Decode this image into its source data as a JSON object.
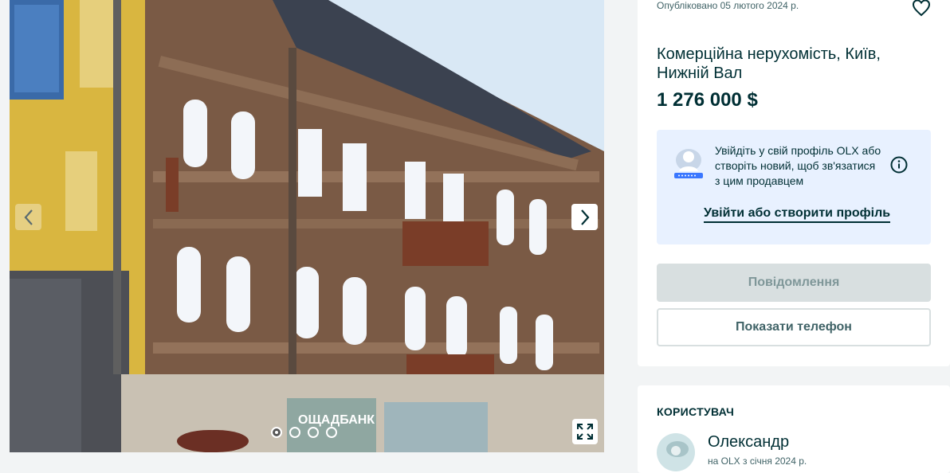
{
  "gallery": {
    "photo_alt": "",
    "slide_count": 4,
    "active_slide": 1
  },
  "listing": {
    "published": "Опубліковано 05 лютого 2024 р.",
    "title": "Комерційна нерухомість, Київ, Нижній Вал",
    "price": "1 276 000 $"
  },
  "login_prompt": {
    "text": "Увійдіть у свій профіль OLX або створіть новий, щоб зв'язатися з цим продавцем",
    "link": "Увійти або створити профіль"
  },
  "actions": {
    "message_label": "Повідомлення",
    "phone_label": "Показати телефон"
  },
  "user": {
    "heading": "КОРИСТУВАЧ",
    "name": "Олександр",
    "since": "на OLX з січня 2024 р."
  },
  "signage": {
    "bank": "ОЩАДБАНК"
  },
  "colors": {
    "accent": "#002f34",
    "login_bg": "#e8f1ff",
    "disabled_btn": "#d8dfe0",
    "page_bg": "#f2f4f5"
  },
  "icons": [
    "chevron-left-icon",
    "chevron-right-icon",
    "heart-icon",
    "info-icon",
    "fullscreen-icon",
    "user-illustration-icon"
  ]
}
